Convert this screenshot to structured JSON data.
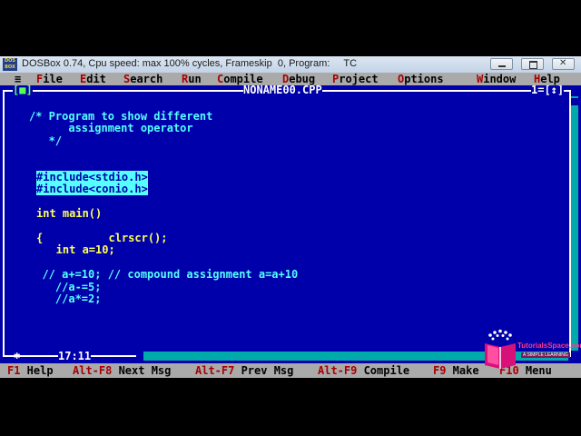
{
  "window": {
    "title": "DOSBox 0.74, Cpu speed: max 100% cycles, Frameskip  0, Program:     TC",
    "icon_label": "DOS BOX"
  },
  "menu": {
    "system": "≡",
    "items": [
      {
        "hot": "F",
        "rest": "ile"
      },
      {
        "hot": "E",
        "rest": "dit"
      },
      {
        "hot": "S",
        "rest": "earch"
      },
      {
        "hot": "R",
        "rest": "un"
      },
      {
        "hot": "C",
        "rest": "ompile"
      },
      {
        "hot": "D",
        "rest": "ebug"
      },
      {
        "hot": "P",
        "rest": "roject"
      },
      {
        "hot": "O",
        "rest": "ptions"
      },
      {
        "hot": "W",
        "rest": "indow"
      },
      {
        "hot": "H",
        "rest": "elp"
      }
    ]
  },
  "editor": {
    "close_box": "[■]",
    "file_name": "NONAME00.CPP",
    "window_controls": "1=[↕]",
    "cursor_position": "17:11",
    "lines": [
      {
        "text": "/* Program to show different",
        "kind": "comment"
      },
      {
        "text": "      assignment operator",
        "kind": "comment"
      },
      {
        "text": "   */",
        "kind": "comment"
      },
      {
        "text": "",
        "kind": "plain"
      },
      {
        "text": "",
        "kind": "plain"
      },
      {
        "text": "#include<stdio.h>",
        "kind": "prep"
      },
      {
        "text": "#include<conio.h>",
        "kind": "prep"
      },
      {
        "text": "",
        "kind": "plain"
      },
      {
        "text": "int main()",
        "kind": "plain"
      },
      {
        "text": "",
        "kind": "plain"
      },
      {
        "text": "{          clrscr();",
        "kind": "plain"
      },
      {
        "text": "   int a=10;",
        "kind": "plain"
      },
      {
        "text": "",
        "kind": "plain"
      },
      {
        "text": "  // a+=10; // compound assignment a=a+10",
        "kind": "comment"
      },
      {
        "text": "    //a-=5;",
        "kind": "comment"
      },
      {
        "text": "    //a*=2;",
        "kind": "comment"
      }
    ]
  },
  "status": [
    {
      "key": "F1",
      "label": " Help"
    },
    {
      "key": "Alt-F8",
      "label": " Next Msg"
    },
    {
      "key": "Alt-F7",
      "label": " Prev Msg"
    },
    {
      "key": "Alt-F9",
      "label": " Compile"
    },
    {
      "key": "F9",
      "label": " Make"
    },
    {
      "key": "F10",
      "label": " Menu"
    }
  ],
  "watermark": {
    "name": "TutorialsSpace.com",
    "tagline": "A SIMPLE LEARNING"
  },
  "colors": {
    "editor_bg": "#0000aa",
    "code_text": "#ffff55",
    "comment": "#55ffff",
    "highlight": "#55ffff",
    "hotkey": "#a80000",
    "bar_bg": "#aaaaaa"
  }
}
